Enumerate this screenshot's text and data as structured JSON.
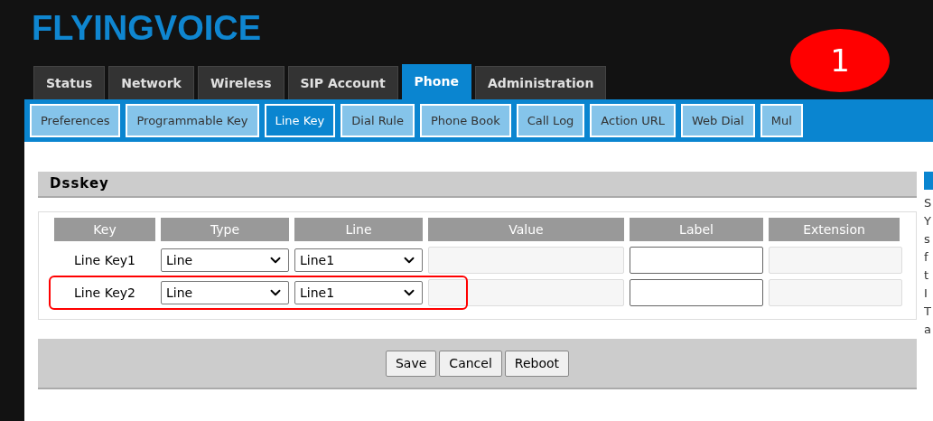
{
  "logo": "FLYINGVOICE",
  "main_tabs": [
    {
      "label": "Status",
      "selected": false
    },
    {
      "label": "Network",
      "selected": false
    },
    {
      "label": "Wireless",
      "selected": false
    },
    {
      "label": "SIP Account",
      "selected": false
    },
    {
      "label": "Phone",
      "selected": true
    },
    {
      "label": "Administration",
      "selected": false
    }
  ],
  "sub_tabs": [
    {
      "label": "Preferences",
      "selected": false
    },
    {
      "label": "Programmable Key",
      "selected": false
    },
    {
      "label": "Line Key",
      "selected": true
    },
    {
      "label": "Dial Rule",
      "selected": false
    },
    {
      "label": "Phone Book",
      "selected": false
    },
    {
      "label": "Call Log",
      "selected": false
    },
    {
      "label": "Action URL",
      "selected": false
    },
    {
      "label": "Web Dial",
      "selected": false
    },
    {
      "label": "Mul",
      "selected": false
    }
  ],
  "annotation": {
    "number": "1"
  },
  "section": {
    "title": "Dsskey"
  },
  "table": {
    "columns": [
      "Key",
      "Type",
      "Line",
      "Value",
      "Label",
      "Extension"
    ],
    "rows": [
      {
        "key": "Line Key1",
        "type": "Line",
        "line": "Line1",
        "highlighted": false
      },
      {
        "key": "Line Key2",
        "type": "Line",
        "line": "Line1",
        "highlighted": true
      }
    ]
  },
  "buttons": [
    "Save",
    "Cancel",
    "Reboot"
  ],
  "help_fragments": [
    "S",
    "Y",
    "s",
    "f",
    "t",
    "I",
    "T",
    "a"
  ]
}
